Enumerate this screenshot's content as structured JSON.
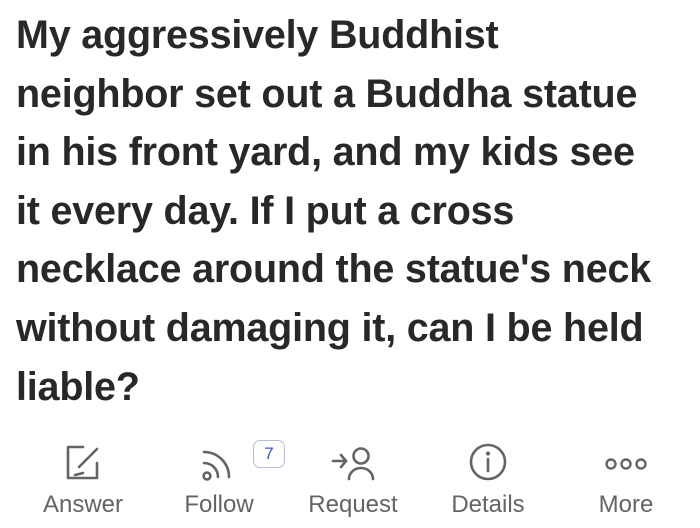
{
  "question": {
    "lines": [
      "My aggressively Buddhist",
      "neighbor set out a Buddha statue",
      "in his front yard, and my kids see",
      "it every day. If I put a cross",
      "necklace around the statue's neck",
      "without damaging it, can I be held",
      "liable?"
    ]
  },
  "actions": {
    "answer": {
      "label": "Answer",
      "icon": "edit-icon"
    },
    "follow": {
      "label": "Follow",
      "icon": "rss-icon",
      "badge": "7"
    },
    "request": {
      "label": "Request",
      "icon": "request-user-icon"
    },
    "details": {
      "label": "Details",
      "icon": "info-icon"
    },
    "more": {
      "label": "More",
      "icon": "more-dots-icon"
    }
  },
  "colors": {
    "text": "#282829",
    "action_text": "#636466",
    "icon": "#636466",
    "badge_text": "#3a58c4",
    "badge_border": "#b7bdd9",
    "background": "#ffffff"
  }
}
